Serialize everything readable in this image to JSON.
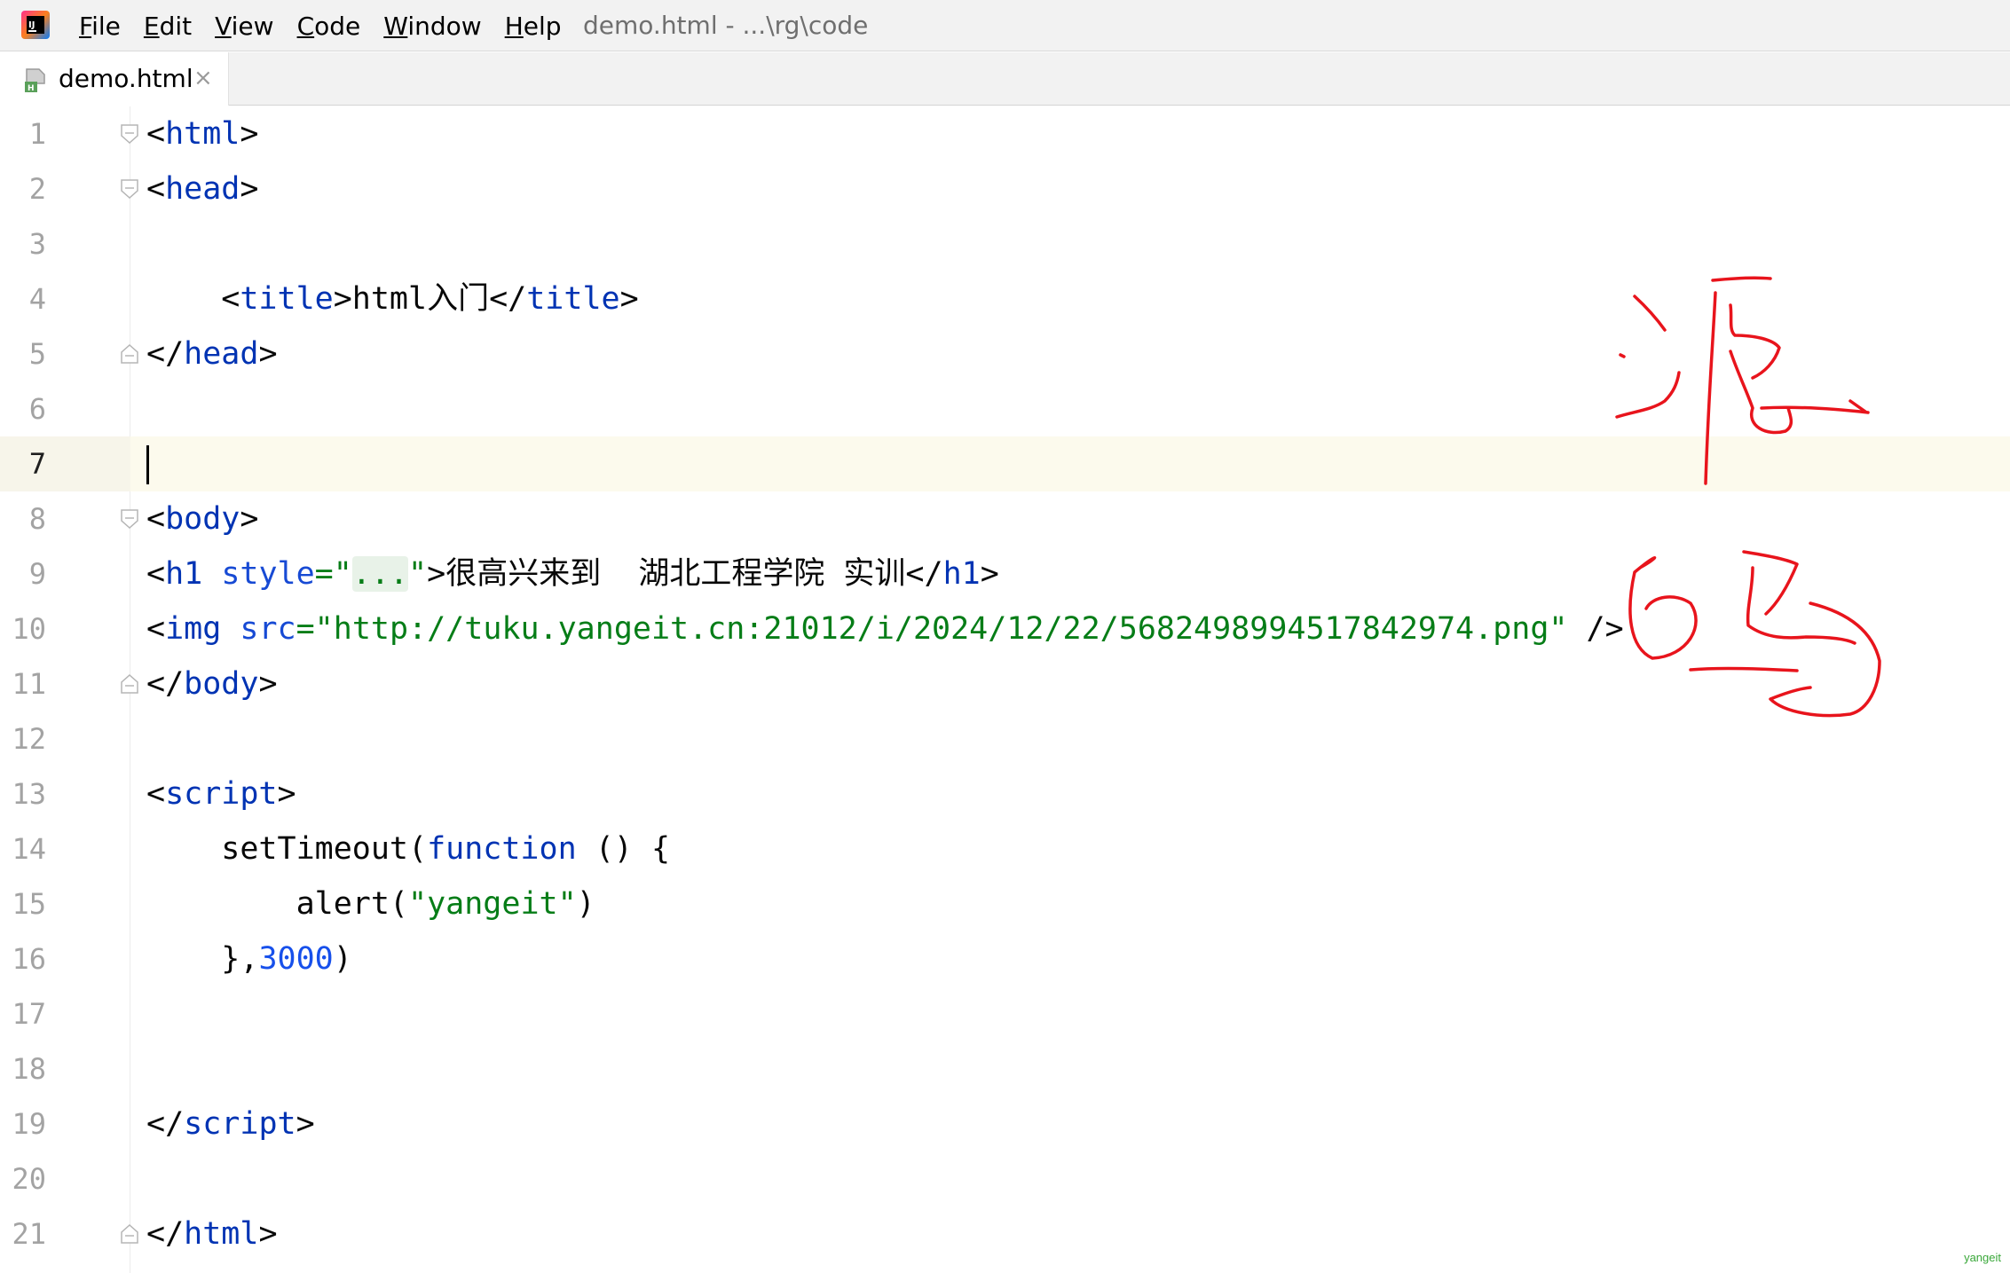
{
  "menubar": {
    "items": [
      {
        "mnemonic": "F",
        "rest": "ile"
      },
      {
        "mnemonic": "E",
        "rest": "dit"
      },
      {
        "mnemonic": "V",
        "rest": "iew"
      },
      {
        "mnemonic": "C",
        "rest": "ode"
      },
      {
        "mnemonic": "W",
        "rest": "indow"
      },
      {
        "mnemonic": "H",
        "rest": "elp"
      }
    ],
    "window_title": "demo.html - ...\\rg\\code",
    "logo_icon": "intellij-logo-icon"
  },
  "tabs": [
    {
      "label": "demo.html",
      "close": "×",
      "icon": "html-file-icon"
    }
  ],
  "editor": {
    "current_line": 7,
    "line_numbers": [
      "1",
      "2",
      "3",
      "4",
      "5",
      "6",
      "7",
      "8",
      "9",
      "10",
      "11",
      "12",
      "13",
      "14",
      "15",
      "16",
      "17",
      "18",
      "19",
      "20",
      "21"
    ],
    "code": {
      "l1": [
        "<",
        "html",
        ">"
      ],
      "l2": [
        "<",
        "head",
        ">"
      ],
      "l4": [
        "    <",
        "title",
        ">html入门</",
        "title",
        ">"
      ],
      "l5": [
        "</",
        "head",
        ">"
      ],
      "l8": [
        "<",
        "body",
        ">"
      ],
      "l9": [
        "<",
        "h1",
        " ",
        "style",
        "=\"",
        "...",
        "\"",
        ">很高兴来到  湖北工程学院 实训</",
        "h1",
        ">"
      ],
      "l10": [
        "<",
        "img",
        " ",
        "src",
        "=",
        "\"http://tuku.yangeit.cn:21012/i/2024/12/22/5682498994517842974.png\"",
        " />"
      ],
      "l11": [
        "</",
        "body",
        ">"
      ],
      "l13": [
        "<",
        "script",
        ">"
      ],
      "l14": [
        "    setTimeout(",
        "function",
        " () {"
      ],
      "l15": [
        "        alert(",
        "\"yangeit\"",
        ")"
      ],
      "l16": [
        "    },",
        "3000",
        ")"
      ],
      "l19": [
        "</",
        "script",
        ">"
      ],
      "l21": [
        "</",
        "html",
        ">"
      ]
    }
  },
  "annotation": {
    "color": "#e8141c"
  },
  "watermark": "yangeit"
}
